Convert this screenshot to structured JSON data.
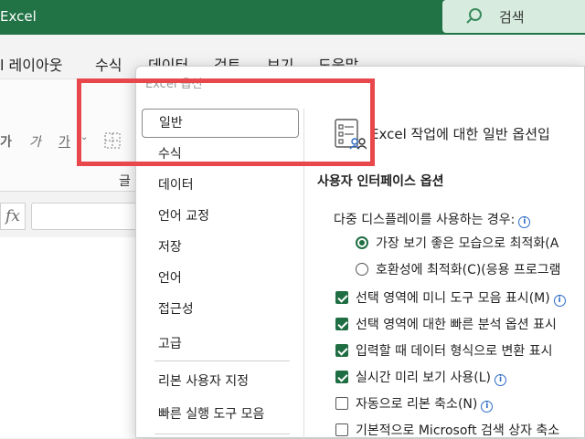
{
  "titlebar": {
    "app_title": "Excel",
    "search_label": "검색",
    "accent_color": "#217346"
  },
  "menubar": {
    "items": [
      "l 레이아웃",
      "수식",
      "데이터",
      "검토",
      "보기",
      "도움말"
    ]
  },
  "ribbon": {
    "font_group_partial": "글",
    "glyphs": [
      "가",
      "가",
      "가"
    ]
  },
  "dialog": {
    "title": "Excel 옵션",
    "nav_items": [
      "일반",
      "수식",
      "데이터",
      "언어 교정",
      "저장",
      "언어",
      "접근성",
      "고급",
      "리본 사용자 지정",
      "빠른 실행 도구 모음"
    ],
    "selected_nav": "일반",
    "header": "Excel 작업에 대한 일반 옵션입",
    "section_ui": "사용자 인터페이스 옵션",
    "multi_display_label": "다중 디스플레이를 사용하는 경우:",
    "radio_best": "가장 보기 좋은 모습으로 최적화(A",
    "radio_compat": "호환성에 최적화(C)(응용 프로그램",
    "checkboxes": [
      {
        "label": "선택 영역에 미니 도구 모음 표시(M)",
        "checked": true
      },
      {
        "label": "선택 영역에 대한 빠른 분석 옵션 표시",
        "checked": true
      },
      {
        "label": "입력할 때 데이터 형식으로 변환 표시",
        "checked": true
      },
      {
        "label": "실시간 미리 보기 사용(L)",
        "checked": true
      },
      {
        "label": "자동으로 리본 축소(N)",
        "checked": false
      },
      {
        "label": "기본적으로 Microsoft 검색 상자 축소",
        "checked": false
      }
    ]
  },
  "annotation": {
    "highlight_color": "#e8484c"
  }
}
